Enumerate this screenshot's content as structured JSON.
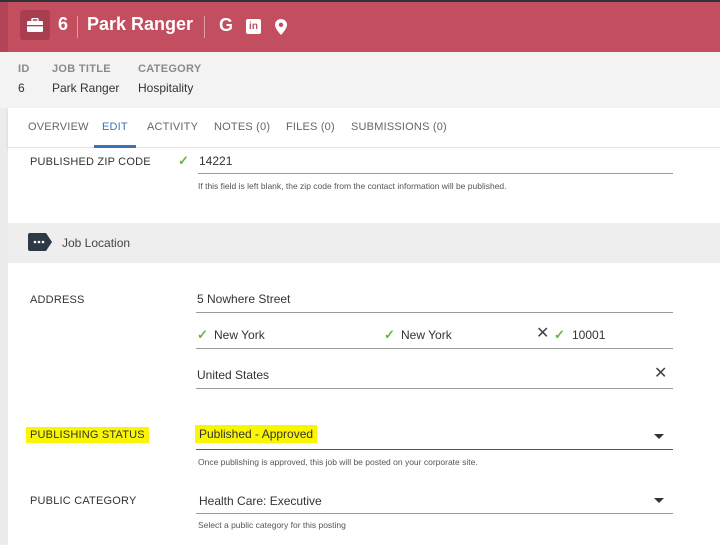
{
  "header": {
    "id": "6",
    "title": "Park Ranger",
    "google_icon_label": "G",
    "linkedin_icon_label": "in"
  },
  "summary": {
    "id_label": "ID",
    "id_value": "6",
    "job_title_label": "JOB TITLE",
    "job_title_value": "Park Ranger",
    "category_label": "CATEGORY",
    "category_value": "Hospitality"
  },
  "tabs": [
    {
      "label": "OVERVIEW"
    },
    {
      "label": "EDIT",
      "active": true
    },
    {
      "label": "ACTIVITY"
    },
    {
      "label": "NOTES (0)"
    },
    {
      "label": "FILES (0)"
    },
    {
      "label": "SUBMISSIONS (0)"
    }
  ],
  "form": {
    "zip": {
      "label": "PUBLISHED ZIP CODE",
      "value": "14221",
      "hint": "If this field is left blank, the zip code from the contact information will be published."
    },
    "section_title": "Job Location",
    "address": {
      "label": "ADDRESS",
      "street": "5 Nowhere Street",
      "city": "New York",
      "state": "New York",
      "postal": "10001",
      "country": "United States"
    },
    "publishing_status": {
      "label": "PUBLISHING STATUS",
      "value": "Published - Approved",
      "hint": "Once publishing is approved, this job will be posted on your corporate site."
    },
    "public_category": {
      "label": "PUBLIC CATEGORY",
      "value": "Health Care: Executive",
      "hint": "Select a public category for this posting"
    }
  },
  "colors": {
    "header": "#c24e60",
    "accent": "#3b73b9",
    "check": "#6bb43f",
    "highlight": "#faf600"
  }
}
